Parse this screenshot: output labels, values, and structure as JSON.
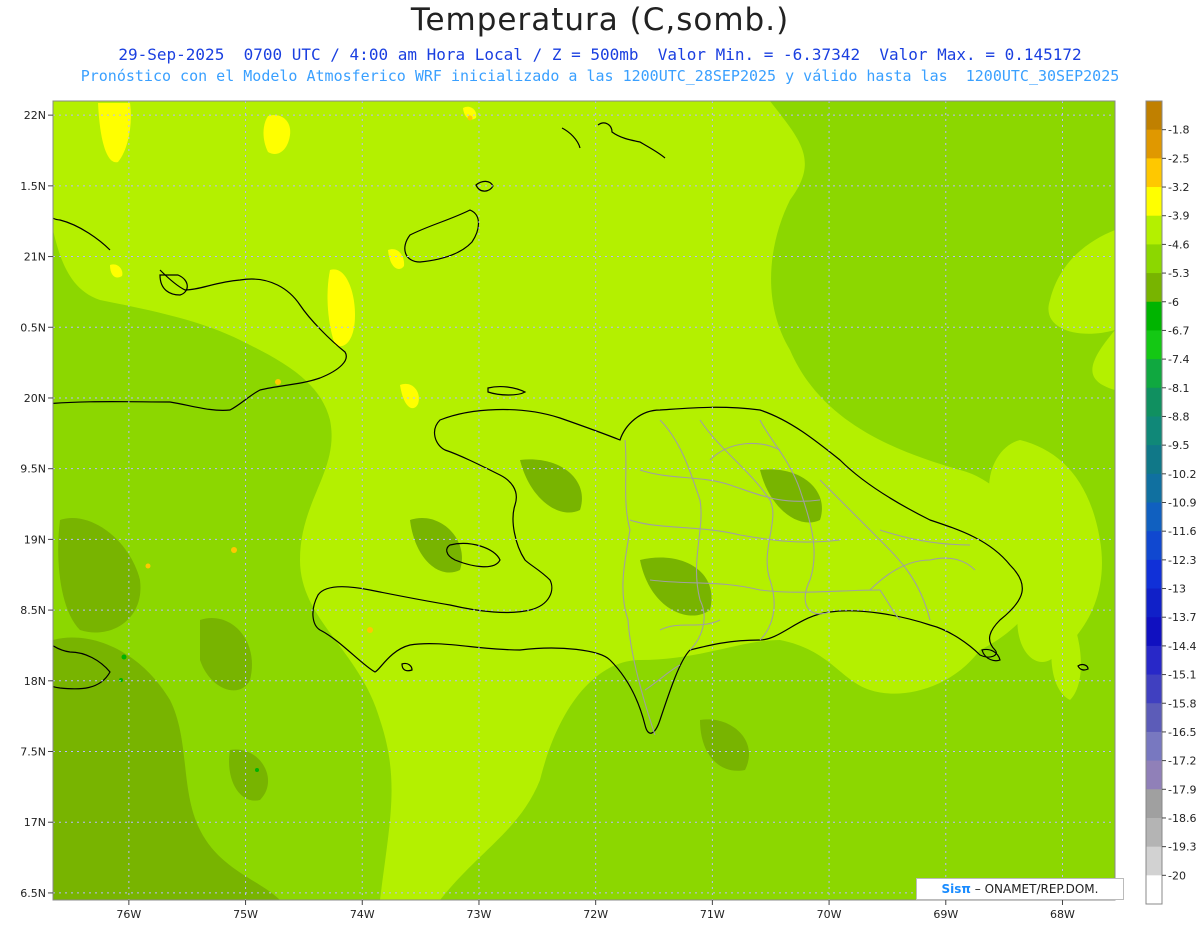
{
  "title": "Temperatura (C,somb.)",
  "subtitle_line1": "29-Sep-2025  0700 UTC / 4:00 am Hora Local / Z = 500mb  Valor Min. = -6.37342  Valor Max. = 0.145172",
  "subtitle_line2": "Pronóstico con el Modelo Atmosferico WRF inicializado a las 1200UTC_28SEP2025 y válido hasta las  1200UTC_30SEP2025",
  "credit": {
    "logo": "Sisπ",
    "text": "– ONAMET/REP.DOM."
  },
  "chart_data": {
    "type": "heatmap",
    "title": "Temperatura (C,somb.)",
    "xlabel": "",
    "ylabel": "",
    "x_ticks": [
      "76W",
      "75W",
      "74W",
      "73W",
      "72W",
      "71W",
      "70W",
      "69W",
      "68W"
    ],
    "y_ticks": [
      "22N",
      "1.5N",
      "21N",
      "0.5N",
      "20N",
      "9.5N",
      "19N",
      "8.5N",
      "18N",
      "7.5N",
      "17N",
      "6.5N"
    ],
    "xlim": [
      -76.65,
      -67.55
    ],
    "ylim": [
      16.45,
      22.1
    ],
    "grid": true,
    "value_min": -6.37342,
    "value_max": 0.145172,
    "colorbar": {
      "levels": [
        "-1.8",
        "-2.5",
        "-3.2",
        "-3.9",
        "-4.6",
        "-5.3",
        "-6",
        "-6.7",
        "-7.4",
        "-8.1",
        "-8.8",
        "-9.5",
        "-10.2",
        "-10.9",
        "-11.6",
        "-12.3",
        "-13",
        "-13.7",
        "-14.4",
        "-15.1",
        "-15.8",
        "-16.5",
        "-17.2",
        "-17.9",
        "-18.6",
        "-19.3",
        "-20"
      ],
      "colors": [
        "#c08000",
        "#e09800",
        "#ffc800",
        "#ffff00",
        "#b4f000",
        "#8cd700",
        "#78b400",
        "#00b400",
        "#14c814",
        "#10a840",
        "#109060",
        "#108878",
        "#107888",
        "#1070a0",
        "#1060c0",
        "#1048d0",
        "#1030d8",
        "#1020c8",
        "#1010c0",
        "#2828c8",
        "#4040c0",
        "#5c5cb8",
        "#7878c0",
        "#9080b8",
        "#a0a0a0",
        "#b4b4b4",
        "#d2d2d2",
        "#ffffff"
      ]
    },
    "field_colors": {
      "dominant": "#8cd700",
      "warm": "#b4f000",
      "warmer": "#ffff00",
      "cold": "#78b400"
    }
  }
}
